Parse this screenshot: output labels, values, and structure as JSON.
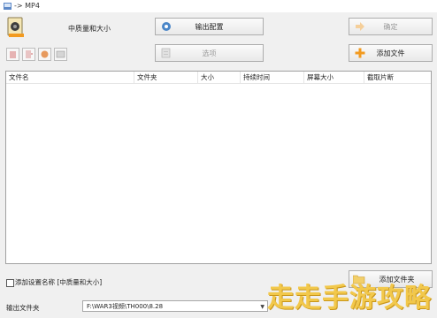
{
  "window": {
    "title": "-> MP4"
  },
  "profile": {
    "label": "中质量和大小"
  },
  "buttons": {
    "output_config": "输出配置",
    "confirm": "确定",
    "options": "选项",
    "add_file": "添加文件",
    "add_folder": "添加文件夹"
  },
  "table": {
    "columns": [
      "文件名",
      "文件夹",
      "大小",
      "持续时间",
      "屏幕大小",
      "截取片断"
    ]
  },
  "settings": {
    "add_setting_name_label": "添加设置名称 [中质量和大小]"
  },
  "output": {
    "label": "输出文件夹",
    "folder_value": "F:\\WAR3视频\\TH000\\8.28"
  },
  "watermark": {
    "text": "走走手游攻略"
  },
  "colors": {
    "accent_orange": "#f29a1f",
    "watermark": "#f2c84b"
  }
}
